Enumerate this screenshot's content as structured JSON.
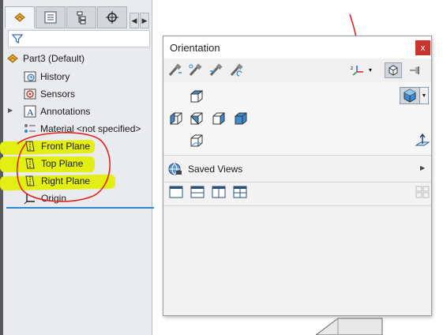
{
  "feature_manager": {
    "tabs": [
      "feature-tree",
      "property-manager",
      "configuration-manager",
      "dimxpert-manager"
    ],
    "part_name": "Part3  (Default)",
    "items": [
      {
        "label": "History",
        "icon": "history-icon"
      },
      {
        "label": "Sensors",
        "icon": "sensors-icon"
      },
      {
        "label": "Annotations",
        "icon": "annotations-icon"
      },
      {
        "label": "Material <not specified>",
        "icon": "material-icon"
      },
      {
        "label": "Front Plane",
        "icon": "plane-icon"
      },
      {
        "label": "Top Plane",
        "icon": "plane-icon"
      },
      {
        "label": "Right Plane",
        "icon": "plane-icon"
      },
      {
        "label": "Origin",
        "icon": "origin-icon"
      }
    ]
  },
  "orientation_dialog": {
    "title": "Orientation",
    "close_label": "x",
    "saved_views_label": "Saved Views"
  },
  "colors": {
    "highlight": "#e3ee12",
    "annotation_red": "#e0241e",
    "selection_blue": "#2a8ad6",
    "close_red": "#c8352f"
  }
}
